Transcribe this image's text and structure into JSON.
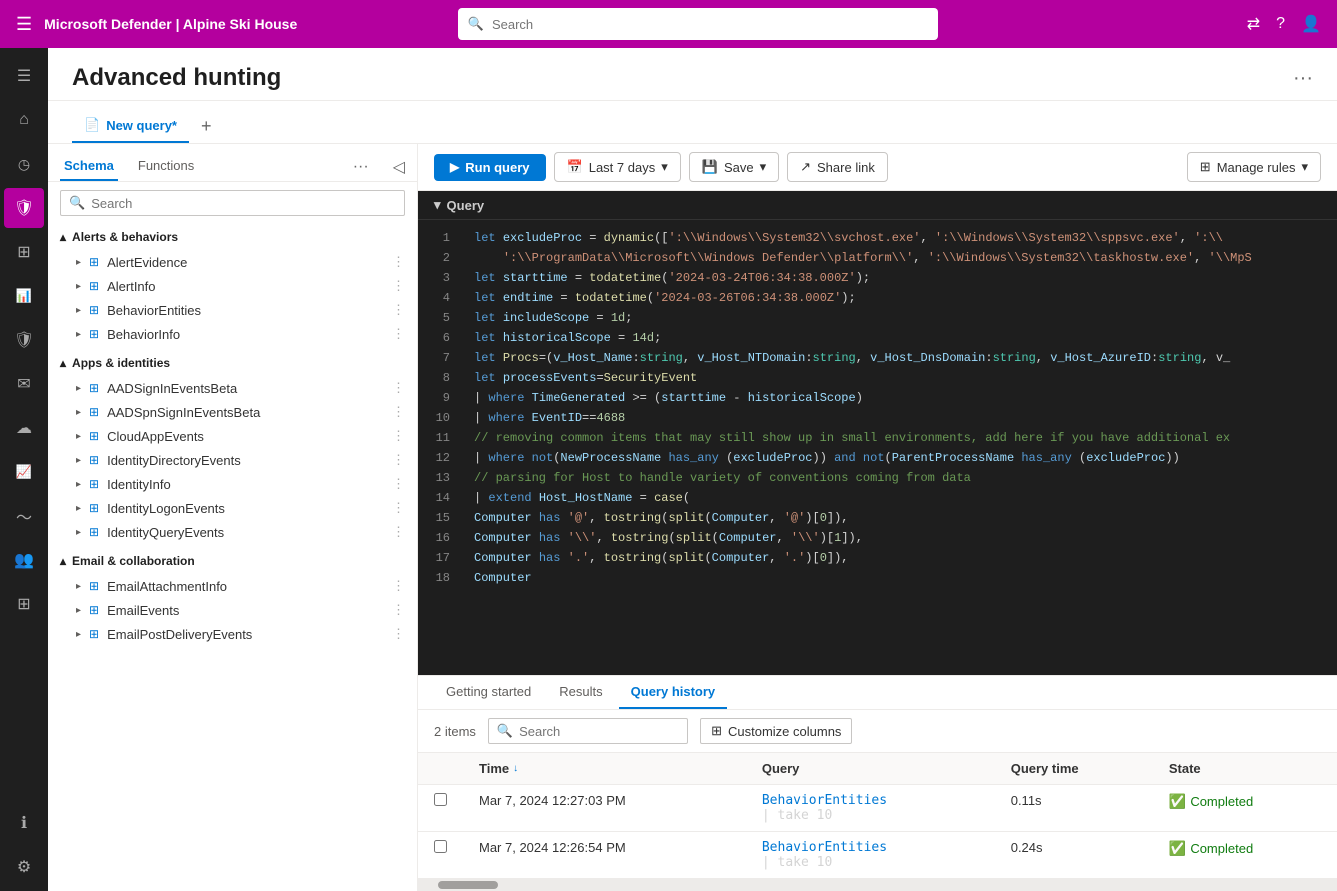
{
  "topbar": {
    "brand": "Microsoft Defender | Alpine Ski House",
    "search_placeholder": "Search"
  },
  "sidenav": {
    "items": [
      {
        "name": "menu",
        "icon": "☰",
        "active": false
      },
      {
        "name": "home",
        "icon": "⌂",
        "active": false
      },
      {
        "name": "clock",
        "icon": "◷",
        "active": false
      },
      {
        "name": "shield",
        "icon": "🛡",
        "active": true
      },
      {
        "name": "grid",
        "icon": "⊞",
        "active": false
      },
      {
        "name": "report",
        "icon": "📊",
        "active": false
      },
      {
        "name": "shield2",
        "icon": "🛡",
        "active": false
      },
      {
        "name": "mail",
        "icon": "✉",
        "active": false
      },
      {
        "name": "cloud",
        "icon": "☁",
        "active": false
      },
      {
        "name": "chart",
        "icon": "📈",
        "active": false
      },
      {
        "name": "lineChart",
        "icon": "〜",
        "active": false
      },
      {
        "name": "people",
        "icon": "👥",
        "active": false
      },
      {
        "name": "apps",
        "icon": "⊞",
        "active": false
      },
      {
        "name": "info",
        "icon": "ℹ",
        "active": false
      }
    ],
    "bottom_items": [
      {
        "name": "settings",
        "icon": "⚙"
      }
    ]
  },
  "page": {
    "title": "Advanced hunting",
    "more_icon": "···"
  },
  "tabs": [
    {
      "label": "New query*",
      "active": true,
      "icon": "📄"
    }
  ],
  "schema": {
    "tab_schema": "Schema",
    "tab_functions": "Functions",
    "search_placeholder": "Search",
    "sections": [
      {
        "name": "alerts-behaviors",
        "label": "Alerts & behaviors",
        "expanded": true,
        "tables": [
          {
            "name": "AlertEvidence"
          },
          {
            "name": "AlertInfo"
          },
          {
            "name": "BehaviorEntities"
          },
          {
            "name": "BehaviorInfo"
          }
        ]
      },
      {
        "name": "apps-identities",
        "label": "Apps & identities",
        "expanded": true,
        "tables": [
          {
            "name": "AADSignInEventsBeta"
          },
          {
            "name": "AADSpnSignInEventsBeta"
          },
          {
            "name": "CloudAppEvents"
          },
          {
            "name": "IdentityDirectoryEvents"
          },
          {
            "name": "IdentityInfo"
          },
          {
            "name": "IdentityLogonEvents"
          },
          {
            "name": "IdentityQueryEvents"
          }
        ]
      },
      {
        "name": "email-collaboration",
        "label": "Email & collaboration",
        "expanded": true,
        "tables": [
          {
            "name": "EmailAttachmentInfo"
          },
          {
            "name": "EmailEvents"
          },
          {
            "name": "EmailPostDeliveryEvents"
          }
        ]
      }
    ]
  },
  "toolbar": {
    "run_label": "Run query",
    "timerange_label": "Last 7 days",
    "save_label": "Save",
    "share_label": "Share link",
    "manage_label": "Manage rules"
  },
  "editor": {
    "section_label": "Query",
    "lines": [
      "let excludeProc = dynamic([':\\\\Windows\\\\System32\\\\svchost.exe', ':\\\\Windows\\\\System32\\\\sppsvc.exe', ':\\\\",
      "    ':\\\\ProgramData\\\\Microsoft\\\\Windows Defender\\\\platform\\\\', ':\\\\Windows\\\\System32\\\\taskhostw.exe', '\\\\MpS",
      "let starttime = todatetime('2024-03-24T06:34:38.000Z');",
      "let endtime = todatetime('2024-03-26T06:34:38.000Z');",
      "let includeScope = 1d;",
      "let historicalScope = 14d;",
      "let Procs=(v_Host_Name:string, v_Host_NTDomain:string, v_Host_DnsDomain:string, v_Host_AzureID:string, v_",
      "let processEvents=SecurityEvent",
      "| where TimeGenerated >= (starttime - historicalScope)",
      "| where EventID==4688",
      "// removing common items that may still show up in small environments, add here if you have additional ex",
      "| where not(NewProcessName has_any (excludeProc)) and not(ParentProcessName has_any (excludeProc))",
      "// parsing for Host to handle variety of conventions coming from data",
      "| extend Host_HostName = case(",
      "Computer has '@', tostring(split(Computer, '@')[0]),",
      "Computer has '\\\\\\\\', tostring(split(Computer, '\\\\\\\\')[1]),",
      "Computer has '.', tostring(split(Computer, '.')[0]),",
      "Computer"
    ]
  },
  "bottom": {
    "tabs": [
      {
        "label": "Getting started",
        "active": false
      },
      {
        "label": "Results",
        "active": false
      },
      {
        "label": "Query history",
        "active": true
      }
    ],
    "items_count": "2 items",
    "search_placeholder": "Search",
    "customize_label": "Customize columns",
    "columns": [
      "Time",
      "Query",
      "Query time",
      "State"
    ],
    "rows": [
      {
        "time": "Mar 7, 2024 12:27:03 PM",
        "query_text": "BehaviorEntities",
        "query_pipe": "| take 10",
        "query_time": "0.11s",
        "state": "Completed"
      },
      {
        "time": "Mar 7, 2024 12:26:54 PM",
        "query_text": "BehaviorEntities",
        "query_pipe": "| take 10",
        "query_time": "0.24s",
        "state": "Completed"
      }
    ]
  }
}
